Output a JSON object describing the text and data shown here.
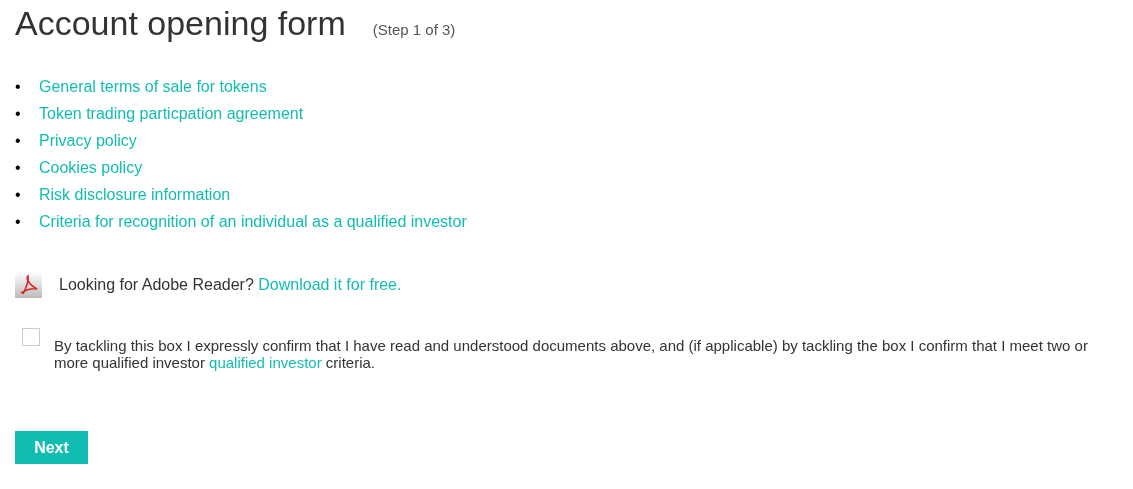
{
  "title": "Account opening form",
  "step": "(Step 1 of 3)",
  "documents": [
    {
      "bullet": "•",
      "label": "General terms of sale for tokens"
    },
    {
      "bullet": "•",
      "label": "Token trading particpation agreement"
    },
    {
      "bullet": "•",
      "label": "Privacy policy"
    },
    {
      "bullet": "•",
      "label": "Cookies policy"
    },
    {
      "bullet": "•",
      "label": "Risk disclosure information"
    },
    {
      "bullet": "•",
      "label": "Criteria for recognition of an individual as a qualified investor"
    }
  ],
  "reader_note": {
    "text": "Looking for Adobe Reader?",
    "link": "Download it for free."
  },
  "consent": {
    "checked": false,
    "text_before": "By tackling this box I expressly confirm that I have read and understood documents above, and (if applicable) by tackling the box I confirm that I meet two or more qualified investor",
    "link": "qualified investor",
    "text_after": "criteria."
  },
  "next_button": "Next"
}
